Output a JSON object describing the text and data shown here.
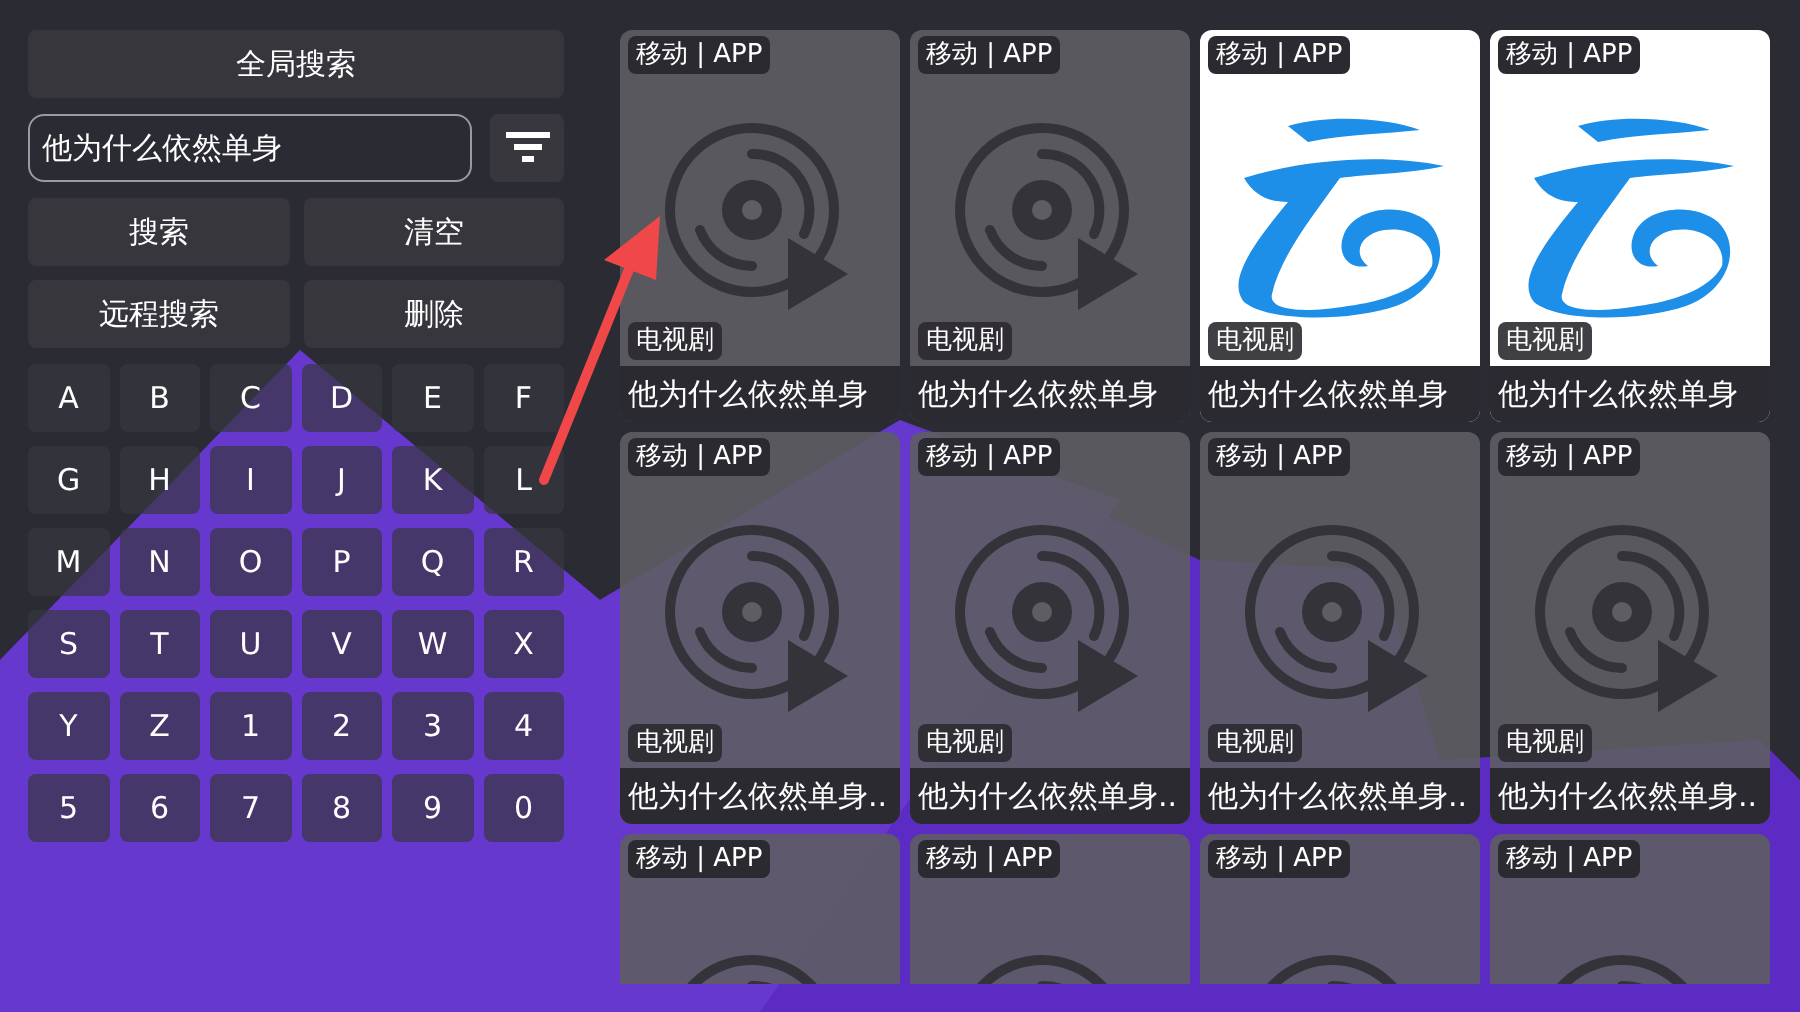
{
  "search_panel": {
    "global_search": "全局搜索",
    "input": {
      "value": "他为什么依然单身"
    },
    "actions": [
      "搜索",
      "清空",
      "远程搜索",
      "删除"
    ],
    "keys": [
      "A",
      "B",
      "C",
      "D",
      "E",
      "F",
      "G",
      "H",
      "I",
      "J",
      "K",
      "L",
      "M",
      "N",
      "O",
      "P",
      "Q",
      "R",
      "S",
      "T",
      "U",
      "V",
      "W",
      "X",
      "Y",
      "Z",
      "1",
      "2",
      "3",
      "4",
      "5",
      "6",
      "7",
      "8",
      "9",
      "0"
    ]
  },
  "results": [
    {
      "kind": "disc",
      "source": "移动 | APP",
      "category": "电视剧",
      "title": "他为什么依然单身"
    },
    {
      "kind": "disc",
      "source": "移动 | APP",
      "category": "电视剧",
      "title": "他为什么依然单身"
    },
    {
      "kind": "logo",
      "source": "移动 | APP",
      "category": "电视剧",
      "title": "他为什么依然单身"
    },
    {
      "kind": "logo",
      "source": "移动 | APP",
      "category": "电视剧",
      "title": "他为什么依然单身"
    },
    {
      "kind": "disc",
      "source": "移动 | APP",
      "category": "电视剧",
      "title": "他为什么依然单身.."
    },
    {
      "kind": "disc",
      "source": "移动 | APP",
      "category": "电视剧",
      "title": "他为什么依然单身.."
    },
    {
      "kind": "disc",
      "source": "移动 | APP",
      "category": "电视剧",
      "title": "他为什么依然单身.."
    },
    {
      "kind": "disc",
      "source": "移动 | APP",
      "category": "电视剧",
      "title": "他为什么依然单身.."
    },
    {
      "kind": "disc",
      "source": "移动 | APP"
    },
    {
      "kind": "disc",
      "source": "移动 | APP"
    },
    {
      "kind": "disc",
      "source": "移动 | APP"
    },
    {
      "kind": "disc",
      "source": "移动 | APP"
    }
  ]
}
